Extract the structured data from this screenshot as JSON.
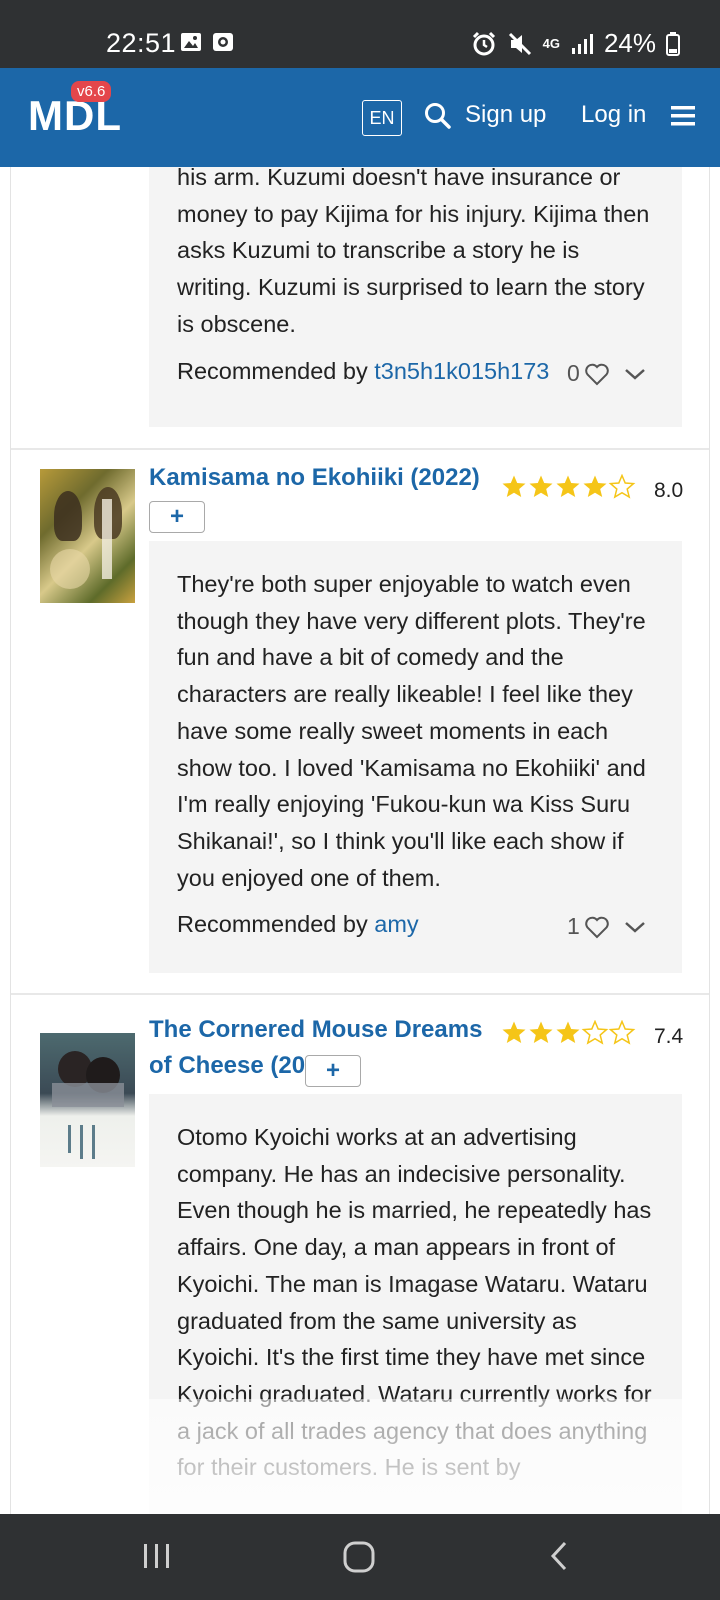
{
  "status_bar": {
    "time": "22:51",
    "network": "4G",
    "battery": "24%"
  },
  "header": {
    "logo": "MDL",
    "version": "v6.6",
    "language": "EN",
    "sign_up": "Sign up",
    "log_in": "Log in"
  },
  "recommendations": [
    {
      "description": "his arm. Kuzumi doesn't have insurance or money to pay Kijima for his injury. Kijima then asks Kuzumi to transcribe a story he is writing. Kuzumi is surprised to learn the story is obscene.",
      "recommended_by_label": "Recommended by",
      "recommended_by_user": "t3n5h1k015h173",
      "likes": "0"
    },
    {
      "title": "Kamisama no Ekohiiki (2022)",
      "rating": "8.0",
      "rating_value": 8.0,
      "add_label": "+",
      "description": "They're both super enjoyable to watch even though they have very different plots. They're fun and have a bit of comedy and the characters are really likeable! I feel like they have some really sweet moments in each show too. I loved 'Kamisama no Ekohiiki' and I'm really enjoying 'Fukou-kun wa Kiss Suru Shikanai!', so I think you'll like each show if you enjoyed one of them.",
      "recommended_by_label": "Recommended by",
      "recommended_by_user": "amy",
      "likes": "1"
    },
    {
      "title": "The Cornered Mouse Dreams of Cheese (2020)",
      "rating": "7.4",
      "rating_value": 7.4,
      "add_label": "+",
      "description": "Otomo Kyoichi works at an advertising company. He has an indecisive personality. Even though he is married, he repeatedly has affairs. One day, a man appears in front of Kyoichi. The man is Imagase Wataru. Wataru graduated from the same university as Kyoichi. It's the first time they have met since Kyoichi graduated. Wataru currently works for a jack of all trades agency that does anything for their customers. He is sent by"
    }
  ],
  "colors": {
    "header_bg": "#1c67a8",
    "link": "#1c67a8",
    "star": "#f5c518",
    "badge": "#e4464b",
    "system_bar": "#2f3133"
  },
  "icons": [
    "image-icon",
    "record-icon",
    "alarm-icon",
    "mute-icon",
    "signal-icon",
    "battery-icon",
    "search-icon",
    "hamburger-menu-icon",
    "heart-icon",
    "chevron-down-icon",
    "star-icon",
    "recent-apps-icon",
    "home-icon",
    "back-icon"
  ]
}
